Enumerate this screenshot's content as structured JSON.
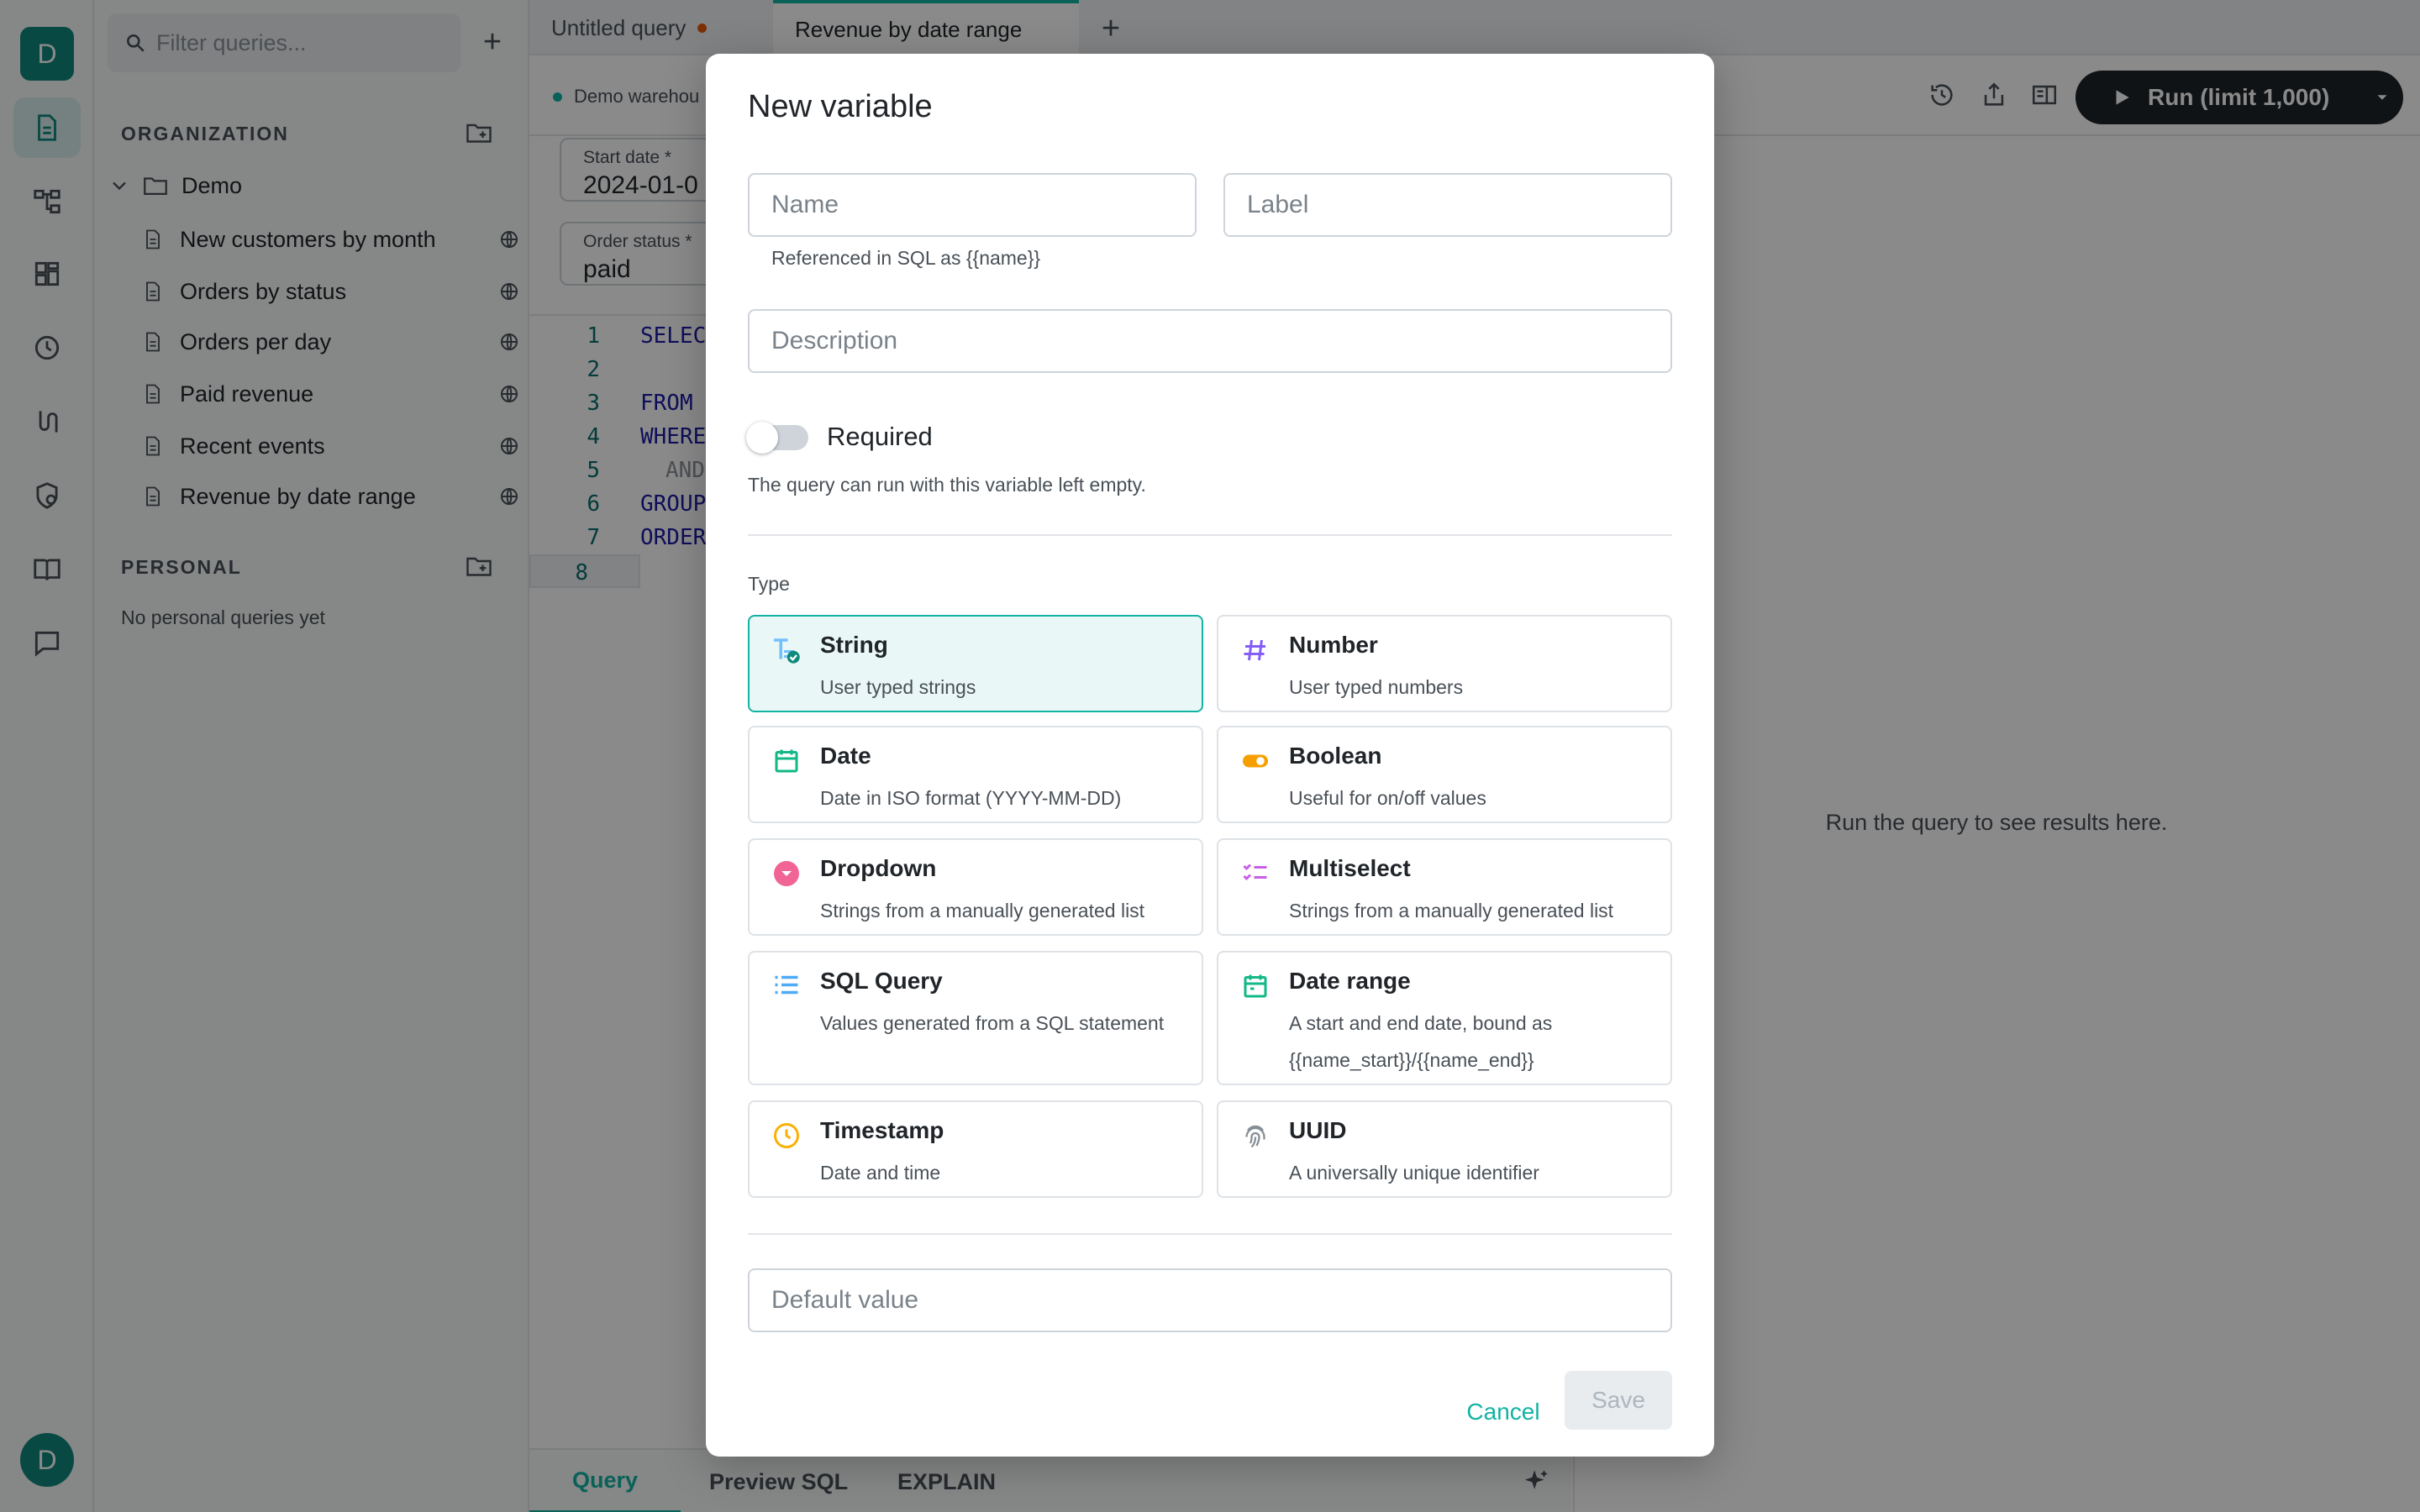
{
  "rail": {
    "avatar_initial": "D",
    "user_initial": "D"
  },
  "sidebar": {
    "filter_placeholder": "Filter queries...",
    "org_title": "ORGANIZATION",
    "folder_name": "Demo",
    "queries": [
      "New customers by month",
      "Orders by status",
      "Orders per day",
      "Paid revenue",
      "Recent events",
      "Revenue by date range"
    ],
    "personal_title": "PERSONAL",
    "personal_empty": "No personal queries yet"
  },
  "tabs": [
    {
      "label": "Untitled query",
      "unsaved": true
    },
    {
      "label": "Revenue by date range",
      "active": true
    }
  ],
  "toolbar": {
    "datasource": "Demo warehou",
    "run_label": "Run (limit 1,000)"
  },
  "params": [
    {
      "label": "Start date",
      "value": "2024-01-0"
    },
    {
      "label": "Order status",
      "value": "paid"
    }
  ],
  "editor": {
    "lines": [
      {
        "n": "1",
        "code": "SELEC"
      },
      {
        "n": "2",
        "code": ""
      },
      {
        "n": "3",
        "code": "FROM"
      },
      {
        "n": "4",
        "code": "WHERE"
      },
      {
        "n": "5",
        "code": "AND"
      },
      {
        "n": "6",
        "code": "GROUP"
      },
      {
        "n": "7",
        "code": "ORDER"
      },
      {
        "n": "8",
        "code": ""
      }
    ]
  },
  "bottom_tabs": [
    "Query",
    "Preview SQL",
    "EXPLAIN"
  ],
  "results_message": "Run the query to see results here.",
  "modal": {
    "title": "New variable",
    "name_placeholder": "Name",
    "label_placeholder": "Label",
    "name_hint": "Referenced in SQL as {{name}}",
    "description_placeholder": "Description",
    "required_label": "Required",
    "required_hint": "The query can run with this variable left empty.",
    "type_label": "Type",
    "types": [
      {
        "title": "String",
        "desc": "User typed strings",
        "icon": "string-type-icon",
        "selected": true
      },
      {
        "title": "Number",
        "desc": "User typed numbers",
        "icon": "hash-icon"
      },
      {
        "title": "Date",
        "desc": "Date in ISO format (YYYY-MM-DD)",
        "icon": "calendar-icon"
      },
      {
        "title": "Boolean",
        "desc": "Useful for on/off values",
        "icon": "toggle-icon"
      },
      {
        "title": "Dropdown",
        "desc": "Strings from a manually generated list",
        "icon": "dropdown-icon"
      },
      {
        "title": "Multiselect",
        "desc": "Strings from a manually generated list",
        "icon": "checklist-icon"
      },
      {
        "title": "SQL Query",
        "desc": "Values generated from a SQL statement",
        "icon": "list-icon"
      },
      {
        "title": "Date range",
        "desc": "A start and end date, bound as {{name_start}}/{{name_end}}",
        "icon": "calendar-range-icon"
      },
      {
        "title": "Timestamp",
        "desc": "Date and time",
        "icon": "clock-icon"
      },
      {
        "title": "UUID",
        "desc": "A universally unique identifier",
        "icon": "fingerprint-icon"
      }
    ],
    "default_placeholder": "Default value",
    "cancel_label": "Cancel",
    "save_label": "Save"
  },
  "colors": {
    "accent": "#12b3a3",
    "brand": "#0f8a7d",
    "run_button": "#1f2328"
  }
}
